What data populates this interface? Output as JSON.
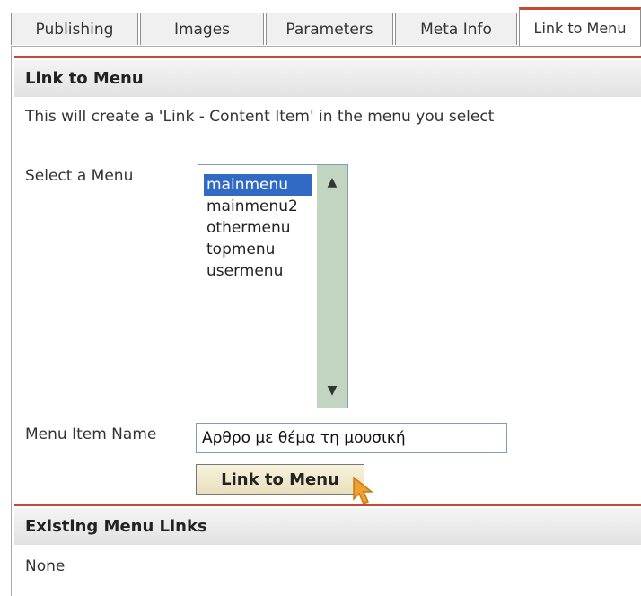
{
  "tabs": [
    {
      "label": "Publishing",
      "active": false
    },
    {
      "label": "Images",
      "active": false
    },
    {
      "label": "Parameters",
      "active": false
    },
    {
      "label": "Meta Info",
      "active": false
    },
    {
      "label": "Link to Menu",
      "active": true
    }
  ],
  "link_section": {
    "title": "Link to Menu",
    "description": "This will create a 'Link - Content Item' in the menu you select",
    "select_label": "Select a Menu",
    "menus": [
      "mainmenu",
      "mainmenu2",
      "othermenu",
      "topmenu",
      "usermenu"
    ],
    "selected_menu": "mainmenu",
    "item_name_label": "Menu Item Name",
    "item_name_value": "Αρθρο με θέμα τη μουσική",
    "button_label": "Link to Menu"
  },
  "existing_section": {
    "title": "Existing Menu Links",
    "value": "None"
  },
  "colors": {
    "accent_red": "#c64934",
    "selection_blue": "#316ac5",
    "scrollbar_green": "#c2d5c0",
    "cursor_orange": "#f0a030"
  }
}
